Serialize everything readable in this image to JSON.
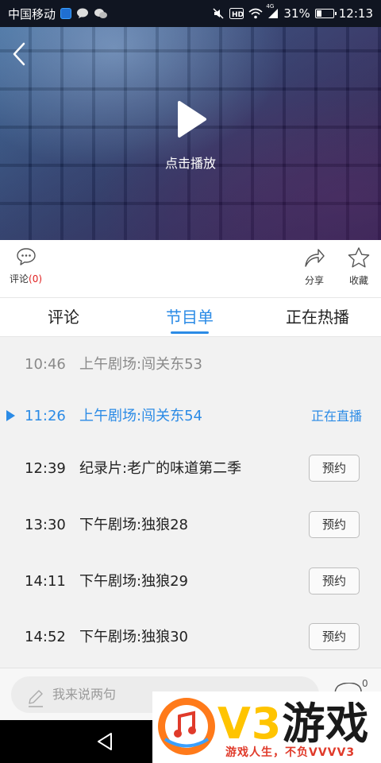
{
  "status_bar": {
    "carrier": "中国移动",
    "network": "4G",
    "battery": "31%",
    "battery_level": 0.31,
    "time": "12:13"
  },
  "video": {
    "play_label": "点击播放"
  },
  "actions": {
    "comment_label": "评论",
    "comment_count": "(0)",
    "share_label": "分享",
    "favorite_label": "收藏"
  },
  "tabs": [
    {
      "label": "评论"
    },
    {
      "label": "节目单"
    },
    {
      "label": "正在热播"
    }
  ],
  "active_tab": "节目单",
  "programs": [
    {
      "time": "10:46",
      "title": "上午剧场:闯关东53",
      "state": "past"
    },
    {
      "time": "11:26",
      "title": "上午剧场:闯关东54",
      "state": "live",
      "status": "正在直播"
    },
    {
      "time": "12:39",
      "title": "纪录片:老广的味道第二季",
      "state": "upcoming",
      "action": "预约"
    },
    {
      "time": "13:30",
      "title": "下午剧场:独狼28",
      "state": "upcoming",
      "action": "预约"
    },
    {
      "time": "14:11",
      "title": "下午剧场:独狼29",
      "state": "upcoming",
      "action": "预约"
    },
    {
      "time": "14:52",
      "title": "下午剧场:独狼30",
      "state": "upcoming",
      "action": "预约"
    }
  ],
  "comment_bar": {
    "placeholder": "我来说两句",
    "count": "0"
  },
  "watermark": {
    "brand_latin": "V3",
    "brand_cn": "游戏",
    "tagline": "游戏人生，不负VVVV3"
  },
  "colors": {
    "accent": "#2b8be6",
    "count_red": "#e02020",
    "brand_yellow": "#ffc400"
  }
}
